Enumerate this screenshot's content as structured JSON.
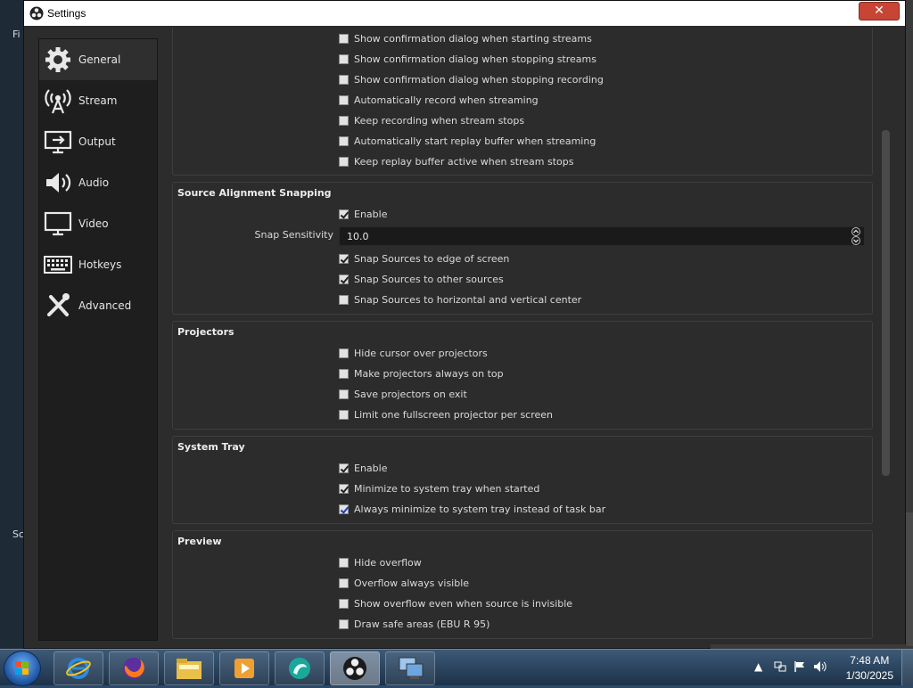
{
  "window": {
    "title": "Settings",
    "close_symbol": "✕"
  },
  "desktop": {
    "left_frag_1": "Fi",
    "left_frag_2": "Sc"
  },
  "sidebar": {
    "items": [
      {
        "label": "General",
        "icon": "gear-icon"
      },
      {
        "label": "Stream",
        "icon": "antenna-icon"
      },
      {
        "label": "Output",
        "icon": "output-icon"
      },
      {
        "label": "Audio",
        "icon": "speaker-icon"
      },
      {
        "label": "Video",
        "icon": "monitor-icon"
      },
      {
        "label": "Hotkeys",
        "icon": "keyboard-icon"
      },
      {
        "label": "Advanced",
        "icon": "tools-icon"
      }
    ]
  },
  "stream_group": {
    "items": [
      {
        "label": "Show confirmation dialog when starting streams",
        "checked": false
      },
      {
        "label": "Show confirmation dialog when stopping streams",
        "checked": false
      },
      {
        "label": "Show confirmation dialog when stopping recording",
        "checked": false
      },
      {
        "label": "Automatically record when streaming",
        "checked": false
      },
      {
        "label": "Keep recording when stream stops",
        "checked": false
      },
      {
        "label": "Automatically start replay buffer when streaming",
        "checked": false
      },
      {
        "label": "Keep replay buffer active when stream stops",
        "checked": false
      }
    ]
  },
  "snapping": {
    "title": "Source Alignment Snapping",
    "enable": {
      "label": "Enable",
      "checked": true
    },
    "sensitivity_label": "Snap Sensitivity",
    "sensitivity_value": "10.0",
    "items": [
      {
        "label": "Snap Sources to edge of screen",
        "checked": true
      },
      {
        "label": "Snap Sources to other sources",
        "checked": true
      },
      {
        "label": "Snap Sources to horizontal and vertical center",
        "checked": false
      }
    ]
  },
  "projectors": {
    "title": "Projectors",
    "items": [
      {
        "label": "Hide cursor over projectors",
        "checked": false
      },
      {
        "label": "Make projectors always on top",
        "checked": false
      },
      {
        "label": "Save projectors on exit",
        "checked": false
      },
      {
        "label": "Limit one fullscreen projector per screen",
        "checked": false
      }
    ]
  },
  "system_tray": {
    "title": "System Tray",
    "items": [
      {
        "label": "Enable",
        "checked": true
      },
      {
        "label": "Minimize to system tray when started",
        "checked": true
      },
      {
        "label": "Always minimize to system tray instead of task bar",
        "checked": true
      }
    ]
  },
  "preview": {
    "title": "Preview",
    "items": [
      {
        "label": "Hide overflow",
        "checked": false
      },
      {
        "label": "Overflow always visible",
        "checked": false
      },
      {
        "label": "Show overflow even when source is invisible",
        "checked": false
      },
      {
        "label": "Draw safe areas (EBU R 95)",
        "checked": false
      }
    ]
  },
  "taskbar": {
    "apps": [
      "internet-explorer-icon",
      "firefox-icon",
      "file-explorer-icon",
      "media-player-icon",
      "app-icon",
      "obs-icon",
      "network-computer-icon"
    ],
    "time": "7:48 AM",
    "date": "1/30/2025"
  }
}
